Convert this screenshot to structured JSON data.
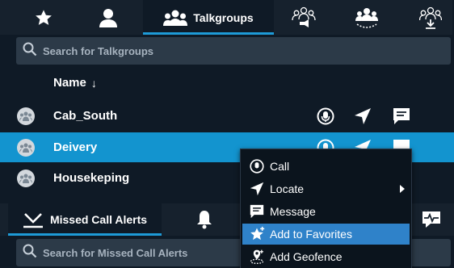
{
  "tabs": [
    {
      "name": "favorites",
      "icon": "star-icon",
      "label": ""
    },
    {
      "name": "contacts",
      "icon": "person-icon",
      "label": ""
    },
    {
      "name": "talkgroups",
      "icon": "group-icon",
      "label": "Talkgroups",
      "active": true
    },
    {
      "name": "broadcast",
      "icon": "broadcast-group-icon",
      "label": ""
    },
    {
      "name": "dynamic-group",
      "icon": "dynamic-group-icon",
      "label": ""
    },
    {
      "name": "download-group",
      "icon": "download-group-icon",
      "label": ""
    }
  ],
  "search": {
    "placeholder": "Search for Talkgroups"
  },
  "list": {
    "column_header": "Name",
    "sort_indicator": "↓",
    "rows": [
      {
        "name": "Cab_South",
        "selected": false
      },
      {
        "name": "Deivery",
        "selected": true
      },
      {
        "name": "Housekeping",
        "selected": false
      }
    ]
  },
  "context_menu": {
    "items": [
      {
        "label": "Call",
        "icon": "ptt-mic-icon"
      },
      {
        "label": "Locate",
        "icon": "location-arrow-icon",
        "submenu": true
      },
      {
        "label": "Message",
        "icon": "message-icon"
      },
      {
        "label": "Add to Favorites",
        "icon": "star-plus-icon",
        "highlighted": true
      },
      {
        "label": "Add Geofence",
        "icon": "geofence-icon"
      }
    ]
  },
  "bottom_tabs": [
    {
      "name": "missed-call-alerts",
      "icon": "missed-call-icon",
      "label": "Missed Call Alerts",
      "active": true
    },
    {
      "name": "alerts",
      "icon": "bell-icon",
      "label": ""
    },
    {
      "name": "activity",
      "icon": "heartbeat-chat-icon",
      "label": ""
    }
  ],
  "bottom_search": {
    "placeholder": "Search for Missed Call Alerts"
  },
  "colors": {
    "accent": "#1e9bd7",
    "selected_row": "#1394cf",
    "menu_highlight": "#2f82c9",
    "background": "#0f1a26",
    "tabbar": "#16212d"
  }
}
